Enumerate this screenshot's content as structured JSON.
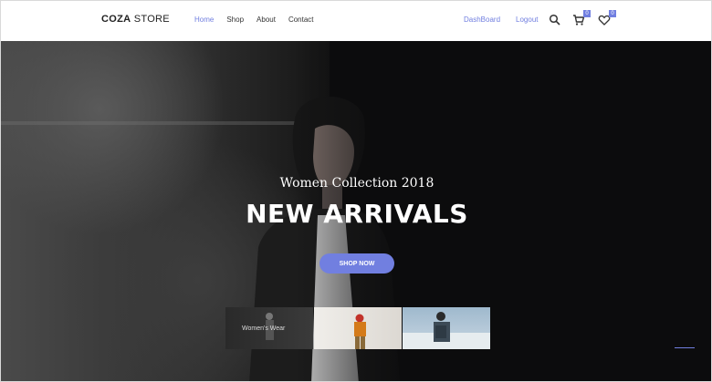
{
  "brand": {
    "name_bold": "COZA",
    "name_light": " STORE"
  },
  "nav": {
    "items": [
      "Home",
      "Shop",
      "About",
      "Contact"
    ],
    "active_index": 0
  },
  "account": {
    "dashboard": "DashBoard",
    "logout": "Logout"
  },
  "icons": {
    "search": "search-icon",
    "cart": "cart-icon",
    "wishlist": "heart-icon"
  },
  "counts": {
    "cart": "0",
    "wishlist": "0"
  },
  "hero": {
    "subtitle": "Women Collection 2018",
    "title": "NEW ARRIVALS",
    "cta": "SHOP NOW"
  },
  "thumbnails": [
    {
      "label": "Women's Wear"
    }
  ],
  "colors": {
    "accent": "#717fe0",
    "hero_bg": "#0c0c0d"
  }
}
